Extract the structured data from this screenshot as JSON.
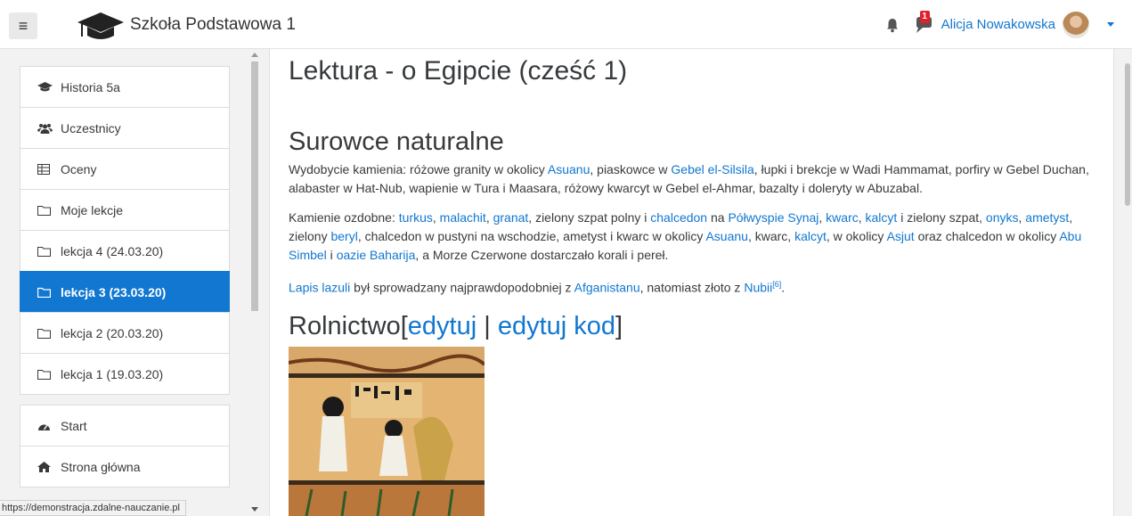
{
  "navbar": {
    "site_name": "Szkoła Podstawowa 1",
    "user_name": "Alicja Nowakowska",
    "message_count": "1"
  },
  "sidebar": {
    "items": [
      {
        "label": "Historia 5a",
        "icon": "graduation-cap-icon"
      },
      {
        "label": "Uczestnicy",
        "icon": "users-icon"
      },
      {
        "label": "Oceny",
        "icon": "table-icon"
      },
      {
        "label": "Moje lekcje",
        "icon": "folder-icon"
      },
      {
        "label": "lekcja 4 (24.03.20)",
        "icon": "folder-icon"
      },
      {
        "label": "lekcja 3 (23.03.20)",
        "icon": "folder-icon",
        "active": true
      },
      {
        "label": "lekcja 2 (20.03.20)",
        "icon": "folder-icon"
      },
      {
        "label": "lekcja 1 (19.03.20)",
        "icon": "folder-icon"
      },
      {
        "label": "Start",
        "icon": "dashboard-icon"
      },
      {
        "label": "Strona główna",
        "icon": "home-icon"
      }
    ]
  },
  "status_url": "https://demonstracja.zdalne-nauczanie.pl",
  "main": {
    "title": "Lektura - o Egipcie (cześć 1)",
    "section1": {
      "heading": "Surowce naturalne",
      "p1": {
        "t1": "Wydobycie kamienia: różowe granity w okolicy ",
        "l1": "Asuanu",
        "t2": ", piaskowce w ",
        "l2": "Gebel el-Silsila",
        "t3": ", łupki i brekcje w Wadi Hammamat, porfiry w Gebel Duchan, alabaster w Hat-Nub, wapienie w Tura i Maasara, różowy kwarcyt w Gebel el-Ahmar, bazalty i doleryty w Abuzabal."
      },
      "p2": {
        "t1": "Kamienie ozdobne: ",
        "l1": "turkus",
        "s1": ", ",
        "l2": "malachit",
        "s2": ", ",
        "l3": "granat",
        "t2": ", zielony szpat polny i ",
        "l4": "chalcedon",
        "t3": " na ",
        "l5": "Półwyspie Synaj",
        "s3": ", ",
        "l6": "kwarc",
        "s4": ", ",
        "l7": "kalcyt",
        "t4": " i zielony szpat, ",
        "l8": "onyks",
        "s5": ", ",
        "l9": "ametyst",
        "t5": ", zielony ",
        "l10": "beryl",
        "t6": ", chalcedon w pustyni na wschodzie, ametyst i kwarc w okolicy ",
        "l11": "Asuanu",
        "t7": ", kwarc, ",
        "l12": "kalcyt",
        "t8": ", w okolicy ",
        "l13": "Asjut",
        "t9": " oraz chalcedon w okolicy ",
        "l14": "Abu Simbel",
        "t10": " i ",
        "l15": "oazie Baharija",
        "t11": ", a Morze Czerwone dostarczało korali i pereł."
      },
      "p3": {
        "l1": "Lapis lazuli",
        "t1": " był sprowadzany najprawdopodobniej z ",
        "l2": "Afganistanu",
        "t2": ", natomiast złoto z ",
        "l3": "Nubii",
        "ref": "[6]",
        "t3": "."
      }
    },
    "section2": {
      "heading": "Rolnictwo",
      "bracket_open": "[",
      "edit": "edytuj",
      "sep": " | ",
      "edit_code": "edytuj kod",
      "bracket_close": "]"
    }
  },
  "colors": {
    "accent": "#1177d1",
    "badge": "#e0212c"
  }
}
